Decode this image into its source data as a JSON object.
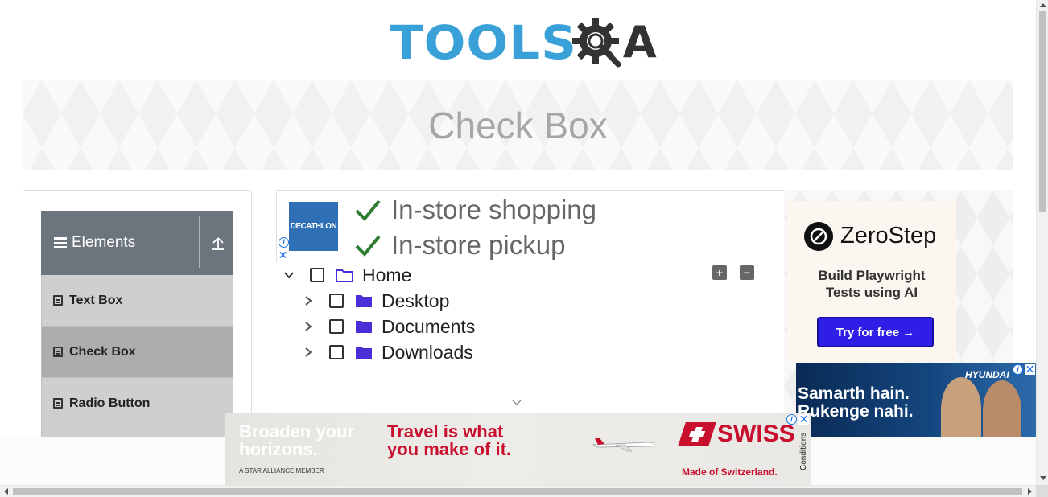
{
  "header": {
    "logo_text": "TOOLS",
    "logo_suffix": "A"
  },
  "page": {
    "title": "Check Box"
  },
  "sidebar": {
    "group": {
      "label": "Elements",
      "icon": "hamburger-icon",
      "collapse_icon": "collapse-up-icon"
    },
    "items": [
      {
        "label": "Text Box",
        "icon": "form-icon"
      },
      {
        "label": "Check Box",
        "icon": "form-icon",
        "active": true
      },
      {
        "label": "Radio Button",
        "icon": "form-icon"
      }
    ]
  },
  "top_ad": {
    "brand": "DECATHLON",
    "lines": [
      "In-store shopping",
      "In-store pickup"
    ],
    "check_color": "#2e7d32"
  },
  "tree": {
    "root": {
      "label": "Home",
      "expanded": true,
      "checked": false
    },
    "children": [
      {
        "label": "Desktop",
        "expanded": false,
        "checked": false
      },
      {
        "label": "Documents",
        "expanded": false,
        "checked": false
      },
      {
        "label": "Downloads",
        "expanded": false,
        "checked": false
      }
    ],
    "expand_all_label": "+",
    "collapse_all_label": "−",
    "folder_color": "#4b2ed6"
  },
  "right_ad": {
    "brand": "ZeroStep",
    "subtitle_line1": "Build Playwright",
    "subtitle_line2": "Tests using AI",
    "cta": "Try for free →"
  },
  "hyundai_ad": {
    "brand": "HYUNDAI",
    "line1": "Samarth hain.",
    "line2": "Rukenge nahi."
  },
  "bottom_ad": {
    "left_line1": "Broaden your",
    "left_line2": "horizons.",
    "mid_line1": "Travel is what",
    "mid_line2": "you make of it.",
    "small": "A STAR ALLIANCE MEMBER",
    "brand": "SWISS",
    "tagline": "Made of Switzerland.",
    "conditions": "Conditions",
    "brand_color": "#c8102e"
  }
}
